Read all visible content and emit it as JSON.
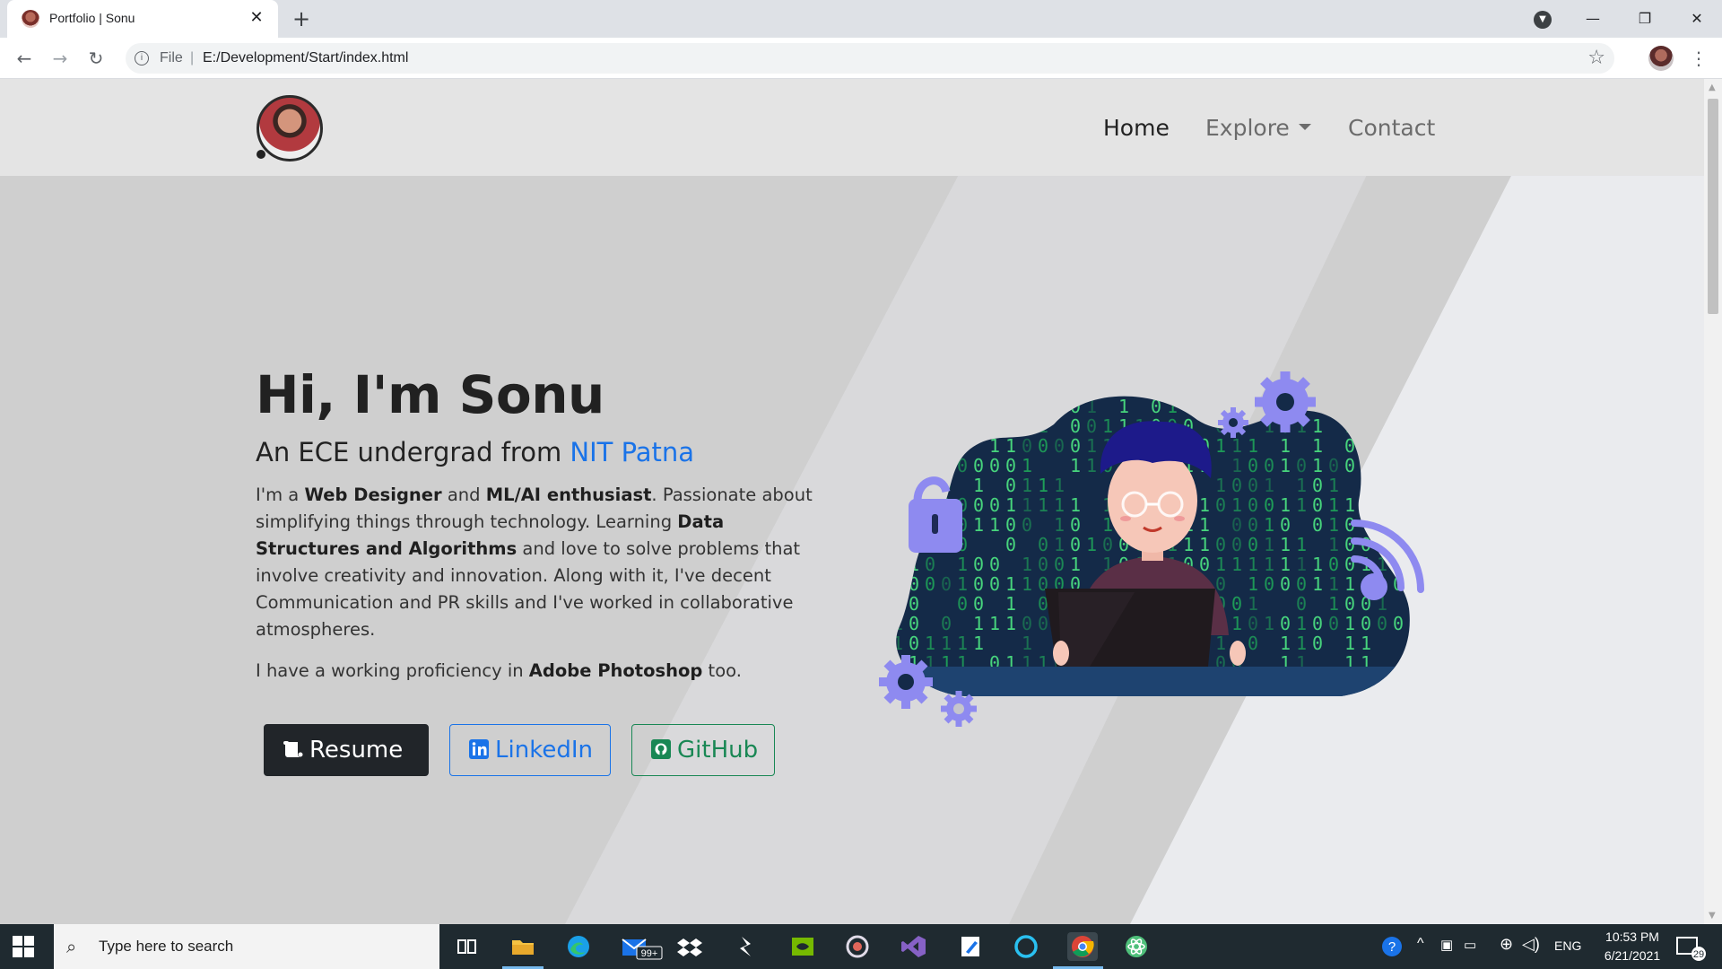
{
  "browser": {
    "tab_title": "Portfolio | Sonu",
    "url_scheme": "File",
    "url_separator": "|",
    "url": "E:/Development/Start/index.html"
  },
  "site": {
    "nav": {
      "home": "Home",
      "explore": "Explore",
      "contact": "Contact"
    },
    "hero": {
      "heading": "Hi, I'm Sonu",
      "subheading_prefix": "An ECE undergrad from ",
      "subheading_highlight": "NIT Patna",
      "p1": {
        "t1": "I'm a ",
        "b1": "Web Designer",
        "t2": " and ",
        "b2": "ML/AI enthusiast",
        "t3": ". Passionate about simplifying things through technology. Learning ",
        "b3": "Data Structures and Algorithms",
        "t4": " and love to solve problems that involve creativity and innovation. Along with it, I've decent Communication and PR skills and I've worked in collaborative atmospheres."
      },
      "p2": {
        "t1": "I have a working proficiency in ",
        "b1": "Adobe Photoshop",
        "t2": " too."
      }
    },
    "buttons": {
      "resume": "Resume",
      "linkedin": "LinkedIn",
      "github": "GitHub"
    }
  },
  "taskbar": {
    "search_placeholder": "Type here to search",
    "mail_badge": "99+",
    "language": "ENG",
    "time": "10:53 PM",
    "date": "6/21/2021",
    "notification_count": "29"
  },
  "colors": {
    "accent_blue": "#1a73e8",
    "github_green": "#198754",
    "dark_button": "#212529"
  },
  "icons": [
    "favicon-icon",
    "close-icon",
    "new-tab-icon",
    "back-arrow-icon",
    "forward-arrow-icon",
    "reload-icon",
    "info-icon",
    "star-icon",
    "kebab-menu-icon",
    "windows-start-icon",
    "search-icon",
    "task-view-icon",
    "file-explorer-icon",
    "edge-icon",
    "mail-icon",
    "dropbox-icon",
    "sublime-icon",
    "nvidia-icon",
    "davinci-icon",
    "visual-studio-icon",
    "notepad-icon",
    "cortana-icon",
    "chrome-icon",
    "atom-icon",
    "help-icon",
    "chevron-up-icon",
    "network-icon",
    "volume-icon",
    "notification-icon"
  ]
}
